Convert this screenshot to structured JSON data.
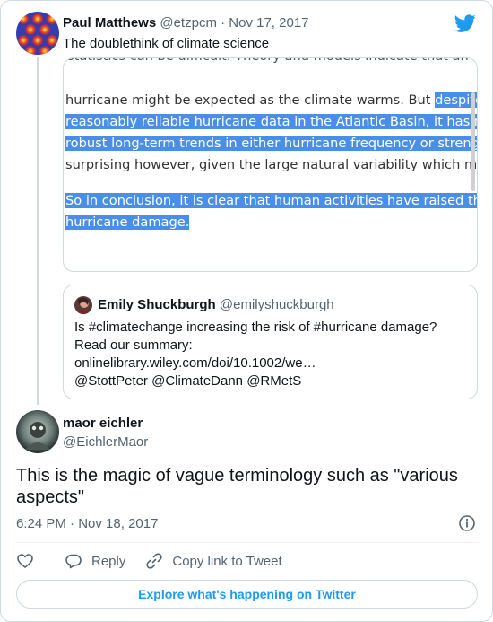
{
  "parent_tweet": {
    "name": "Paul Matthews",
    "handle": "@etzpcm",
    "sep": "·",
    "date": "Nov 17, 2017",
    "text": "The doublethink of climate science",
    "media": {
      "line_top": "statistics can be difficult. Theory and models indicate that an incr",
      "line1_plain": "hurricane might be expected as the climate warms. But ",
      "line1_hl": "despite ov",
      "line2_hl": "reasonably reliable hurricane data in the Atlantic Basin, it has not b",
      "line3_hl": "robust long-term trends in either hurricane frequency or strength",
      "line_cut": "surprising however, given the large natural variability which make",
      "line4_hl": "So in conclusion, it is clear that human activities have raised the ris",
      "line5_hl": "hurricane damage."
    }
  },
  "quoted_tweet": {
    "name": "Emily Shuckburgh",
    "handle": "@emilyshuckburgh",
    "line1": "Is #climatechange increasing the risk of #hurricane damage?",
    "line2": "Read our summary:",
    "line3": "onlinelibrary.wiley.com/doi/10.1002/we…",
    "line4": "@StottPeter @ClimateDann @RMetS"
  },
  "main_tweet": {
    "name": "maor eichler",
    "handle": "@EichlerMaor",
    "text": "This is the magic of vague terminology such as \"various aspects\"",
    "time": "6:24 PM",
    "sep": "·",
    "date": "Nov 18, 2017"
  },
  "actions": {
    "reply_label": "Reply",
    "copy_label": "Copy link to Tweet"
  },
  "explore_label": "Explore what's happening on Twitter",
  "colors": {
    "accent": "#1d9bf0",
    "highlight": "#4a8fe7",
    "muted": "#536471",
    "border": "#cfd9de"
  }
}
